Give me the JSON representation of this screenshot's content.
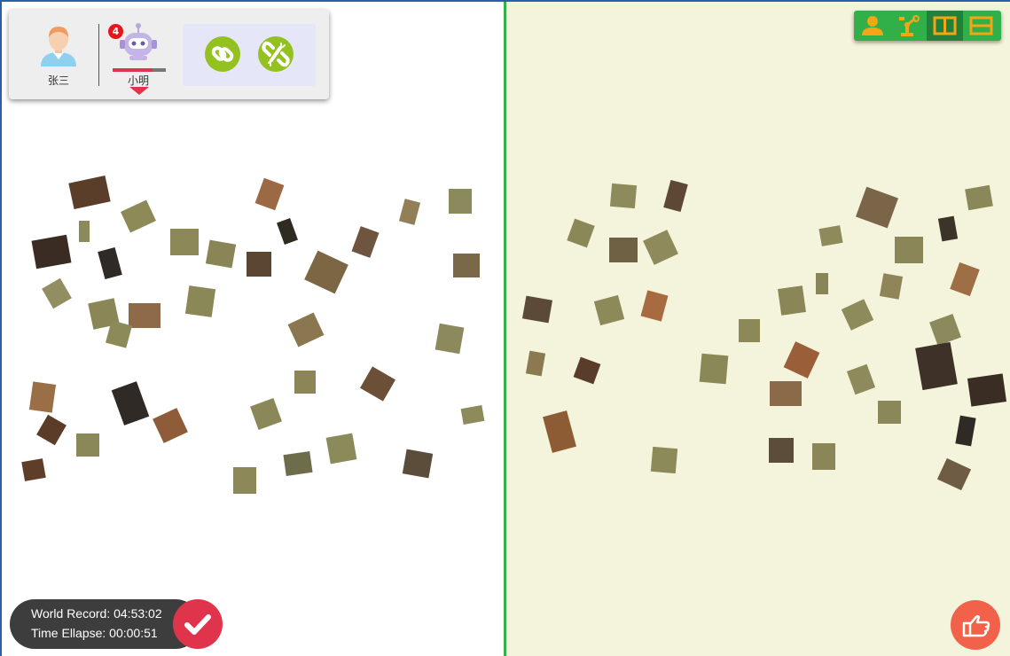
{
  "players": [
    {
      "name": "张三",
      "type": "human",
      "avatar_icon": "person-avatar-icon"
    },
    {
      "name": "小明",
      "type": "robot",
      "avatar_icon": "robot-avatar-icon",
      "notification_count": "4",
      "progress": 0.75
    }
  ],
  "actions": {
    "link_icon": "link-icon",
    "unlink_icon": "unlink-icon"
  },
  "toolbar": {
    "buttons": [
      {
        "icon": "person-icon",
        "active": false
      },
      {
        "icon": "robot-arm-icon",
        "active": false
      },
      {
        "icon": "split-vertical-icon",
        "active": true
      },
      {
        "icon": "split-horizontal-icon",
        "active": false
      }
    ]
  },
  "timer": {
    "world_record": "World Record: 04:53:02",
    "time_elapsed": "Time Ellapse: 00:00:51"
  },
  "buttons": {
    "submit_icon": "checkmark-icon",
    "hint_icon": "pointing-hand-icon"
  },
  "colors": {
    "left_board_bg": "#ffffff",
    "right_board_bg": "#f4f3db",
    "divider": "#36b04a",
    "accent_red": "#e0344c",
    "toolbar_green": "#31b04a",
    "link_green": "#93c11f",
    "hint_orange": "#f2614a"
  }
}
